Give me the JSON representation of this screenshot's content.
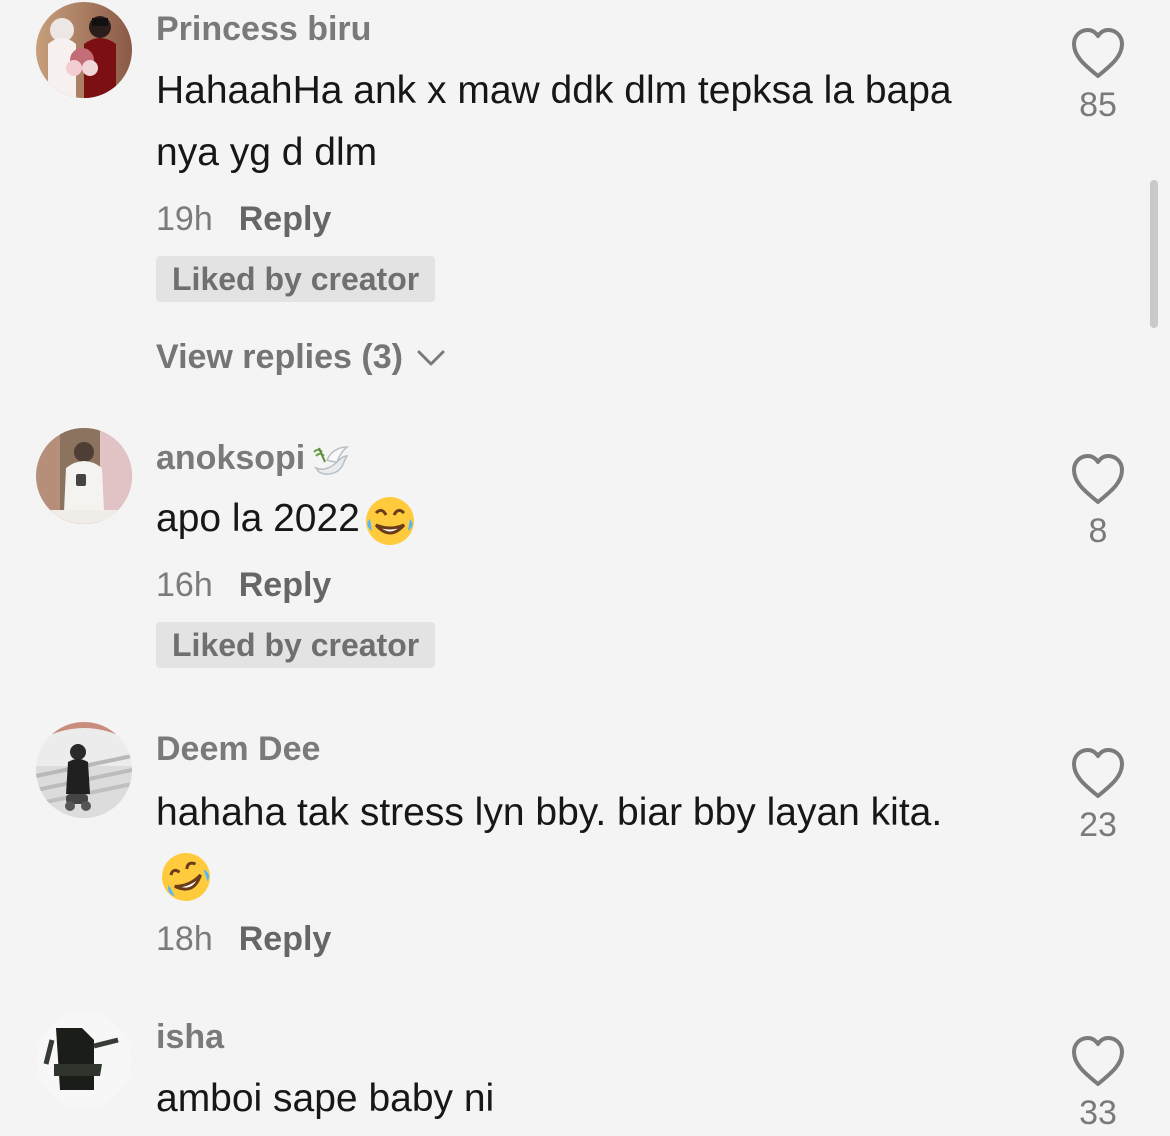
{
  "comments": [
    {
      "username": "Princess biru",
      "text": "HahaahHa ank x maw ddk dlm tepksa la bapa nya yg d dlm",
      "time": "19h",
      "reply_label": "Reply",
      "liked_badge": "Liked by creator",
      "view_replies": "View replies (3)",
      "likes": "85"
    },
    {
      "username": "anoksopi",
      "text": "apo la 2022",
      "time": "16h",
      "reply_label": "Reply",
      "liked_badge": "Liked by creator",
      "likes": "8"
    },
    {
      "username": "Deem Dee",
      "text": "hahaha tak stress lyn bby. biar bby layan kita.",
      "time": "18h",
      "reply_label": "Reply",
      "likes": "23"
    },
    {
      "username": "isha",
      "text": "amboi sape baby ni",
      "likes": "33"
    }
  ],
  "icons": {
    "heart": "heart-icon",
    "chevron": "chevron-down-icon",
    "leaf": "dove-emoji-icon",
    "laugh": "laughing-emoji-icon",
    "rofl": "rolling-laughing-emoji-icon"
  },
  "colors": {
    "background": "#f4f4f4",
    "username": "#7a7a7a",
    "text": "#171717",
    "muted": "#7b7b7b",
    "badge": "#e3e3e3"
  }
}
